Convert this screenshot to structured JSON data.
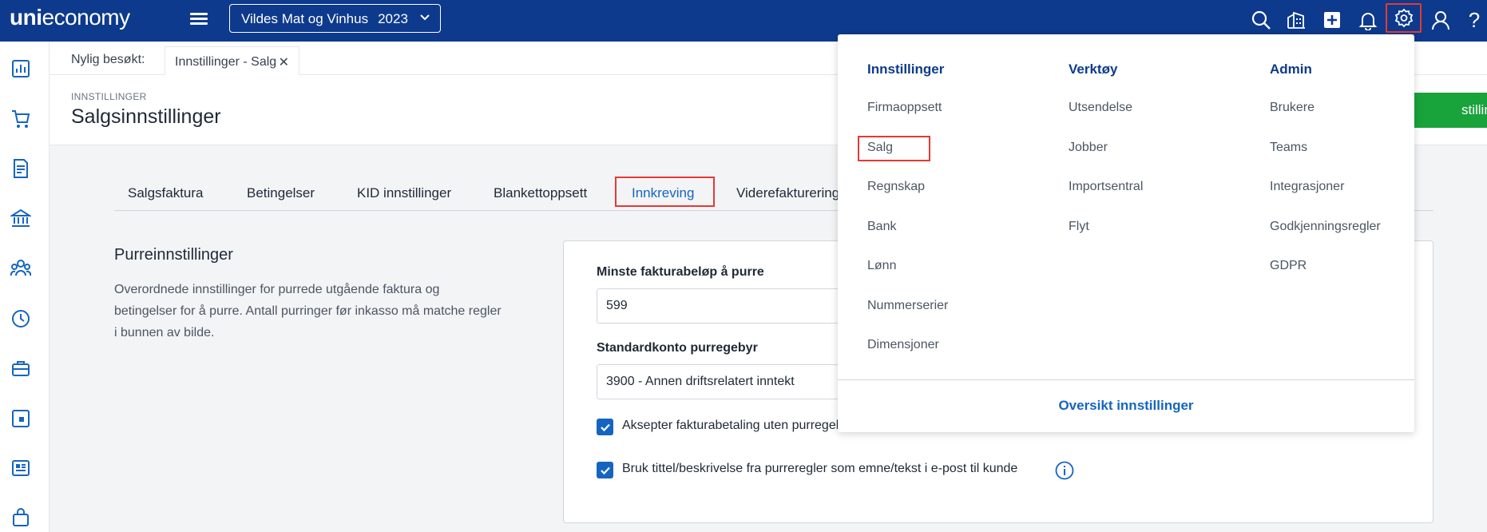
{
  "topbar": {
    "logo_bold": "uni",
    "logo_rest": "economy",
    "company_name": "Vildes Mat og Vinhus",
    "company_year": "2023",
    "icons": [
      "search-icon",
      "companies-icon",
      "add-icon",
      "bell-icon",
      "gear-icon",
      "user-icon",
      "help-icon"
    ]
  },
  "sidebar": {
    "icons": [
      "dashboard-icon",
      "cart-icon",
      "invoice-icon",
      "bank-icon",
      "people-icon",
      "clock-icon",
      "briefcase-icon",
      "screen-icon",
      "report-icon",
      "bag-icon"
    ]
  },
  "recent": {
    "label": "Nylig besøkt:",
    "tab_label": "Innstillinger - Salg",
    "close": "✕"
  },
  "header": {
    "breadcrumb": "INNSTILLINGER",
    "title": "Salgsinnstillinger",
    "button_label": "stillinger"
  },
  "tabs": [
    {
      "label": "Salgsfaktura"
    },
    {
      "label": "Betingelser"
    },
    {
      "label": "KID innstillinger"
    },
    {
      "label": "Blankettoppsett"
    },
    {
      "label": "Innkreving"
    },
    {
      "label": "Viderefakturering"
    }
  ],
  "content": {
    "section_title": "Purreinnstillinger",
    "section_desc": "Overordnede innstillinger for purrede utgående faktura og betingelser for å purre. Antall purringer før inkasso må matche regler i bunnen av bilde.",
    "min_amount_label": "Minste fakturabeløp å purre",
    "min_amount_value": "599",
    "account_label": "Standardkonto purregebyr",
    "account_value": "3900 - Annen driftsrelatert inntekt",
    "checkbox1_label": "Aksepter fakturabetaling uten purregebyr",
    "checkbox2_label": "Bruk tittel/beskrivelse fra purreregler som emne/tekst i e-post til kunde"
  },
  "menu": {
    "columns": [
      {
        "heading": "Innstillinger",
        "items": [
          "Firmaoppsett",
          "Salg",
          "Regnskap",
          "Bank",
          "Lønn",
          "Nummerserier",
          "Dimensjoner"
        ]
      },
      {
        "heading": "Verktøy",
        "items": [
          "Utsendelse",
          "Jobber",
          "Importsentral",
          "Flyt"
        ]
      },
      {
        "heading": "Admin",
        "items": [
          "Brukere",
          "Teams",
          "Integrasjoner",
          "Godkjenningsregler",
          "GDPR"
        ]
      }
    ],
    "footer": "Oversikt innstillinger"
  },
  "colors": {
    "topbar": "#0d3a8c",
    "accent": "#1565c0",
    "highlight": "#e53935",
    "green": "#18a33b"
  }
}
